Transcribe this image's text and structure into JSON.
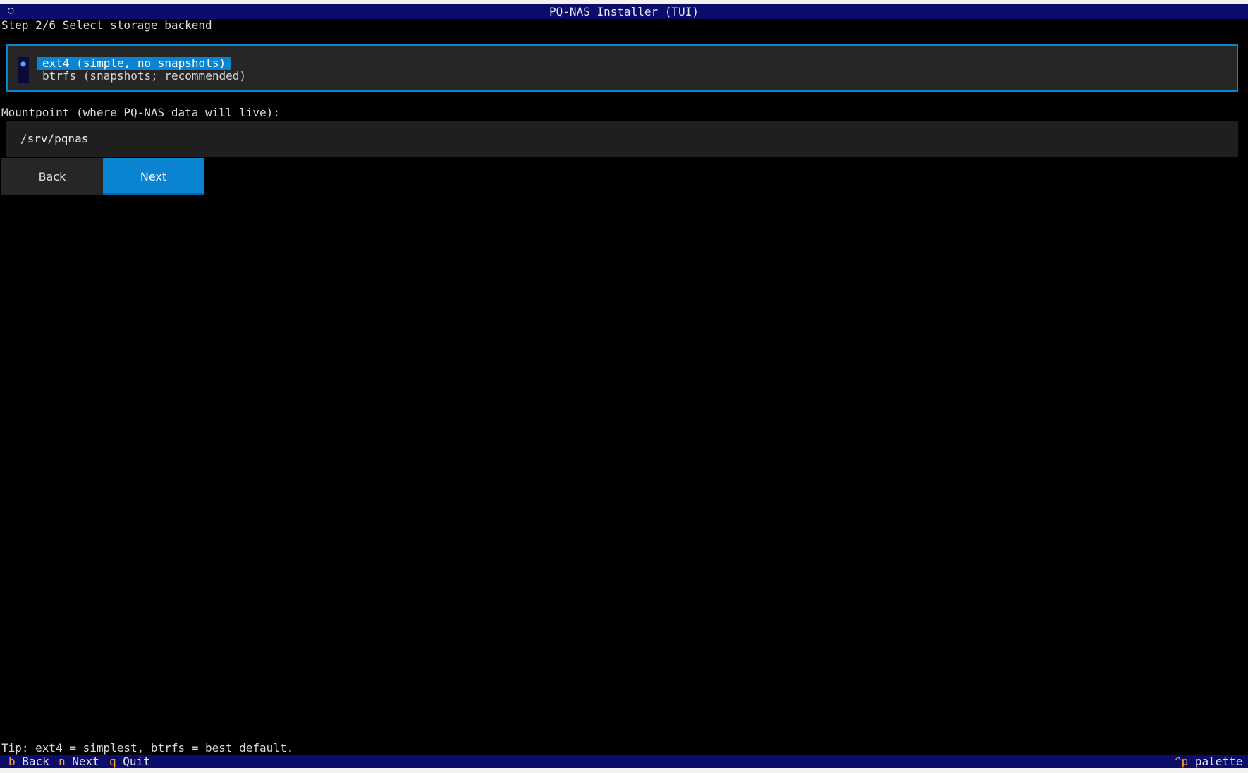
{
  "window": {
    "title": "PQ-NAS Installer (TUI)",
    "title_icon": "○"
  },
  "step": {
    "text": "Step 2/6 Select storage backend"
  },
  "storage_options": [
    {
      "label": "ext4 (simple, no snapshots)",
      "selected": true,
      "marker": "●"
    },
    {
      "label": "btrfs (snapshots; recommended)",
      "selected": false,
      "marker": ""
    }
  ],
  "mountpoint": {
    "label": "Mountpoint (where PQ-NAS data will live):",
    "value": "/srv/pqnas"
  },
  "buttons": {
    "back": "Back",
    "next": "Next"
  },
  "tip": "Tip: ext4 = simplest, btrfs = best default.",
  "footer": {
    "keys": [
      {
        "key": "b",
        "label": "Back"
      },
      {
        "key": "n",
        "label": "Next"
      },
      {
        "key": "q",
        "label": "Quit"
      }
    ],
    "palette": {
      "key": "^p",
      "label": "palette"
    }
  },
  "colors": {
    "accent": "#0a84d0",
    "titlebar": "#0c0c6b",
    "key": "#ffa62b",
    "background": "#000000"
  }
}
